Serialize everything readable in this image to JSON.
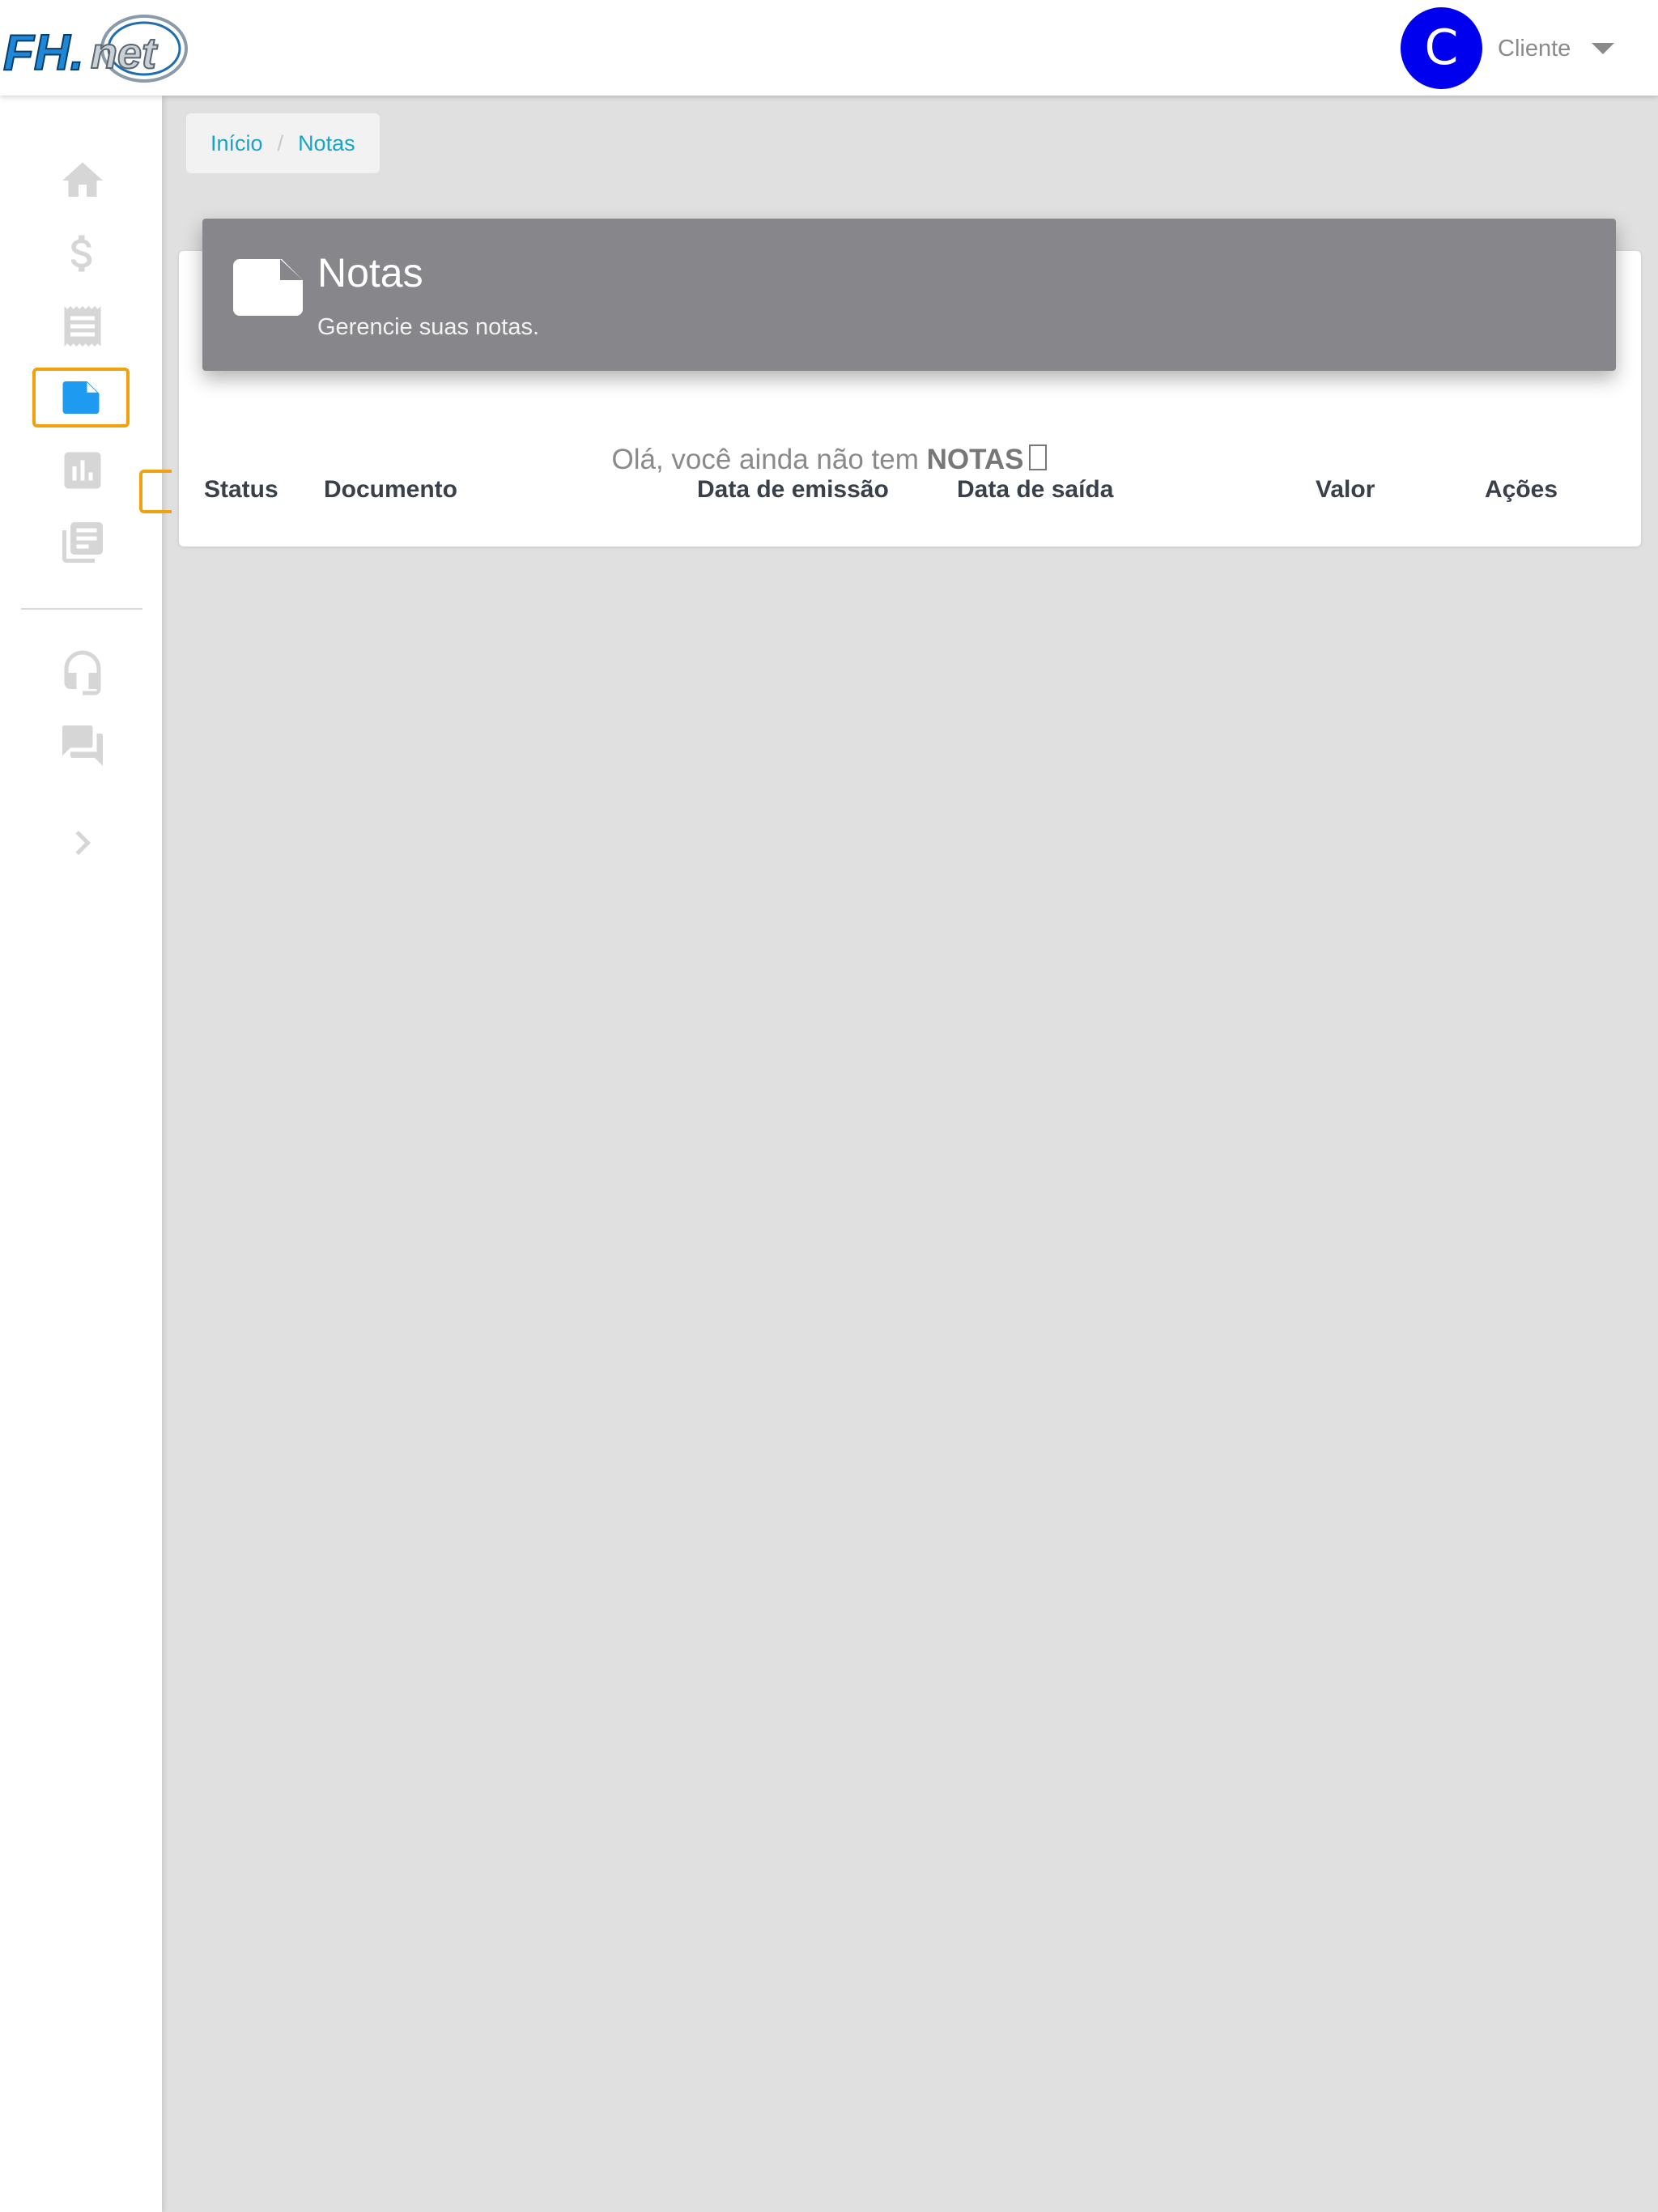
{
  "app": {
    "logo_text": "FH.net",
    "avatar_letter": "C",
    "user_menu_label": "Cliente"
  },
  "sidebar": {
    "items": [
      {
        "icon": "home-icon"
      },
      {
        "icon": "dollar-icon"
      },
      {
        "icon": "receipt-icon"
      },
      {
        "icon": "note-icon",
        "active": true
      },
      {
        "icon": "bar-chart-icon"
      },
      {
        "icon": "library-icon"
      },
      {
        "icon": "headset-icon"
      },
      {
        "icon": "chat-icon"
      },
      {
        "icon": "chevron-right-icon"
      }
    ],
    "accent_color": "#f0a20e",
    "active_icon_color": "#1e9bf0",
    "icon_color": "#d6d6d6"
  },
  "breadcrumb": {
    "home": "Início",
    "separator": "/",
    "current": "Notas"
  },
  "page_header": {
    "title": "Notas",
    "subtitle": "Gerencie suas notas.",
    "background": "#87878b"
  },
  "notes_table": {
    "empty_message_prefix": "Olá, você ainda não tem",
    "empty_message_highlight": "NOTAS",
    "columns": [
      "Status",
      "Documento",
      "Data de emissão",
      "Data de saída",
      "Valor",
      "Ações"
    ],
    "rows": []
  }
}
